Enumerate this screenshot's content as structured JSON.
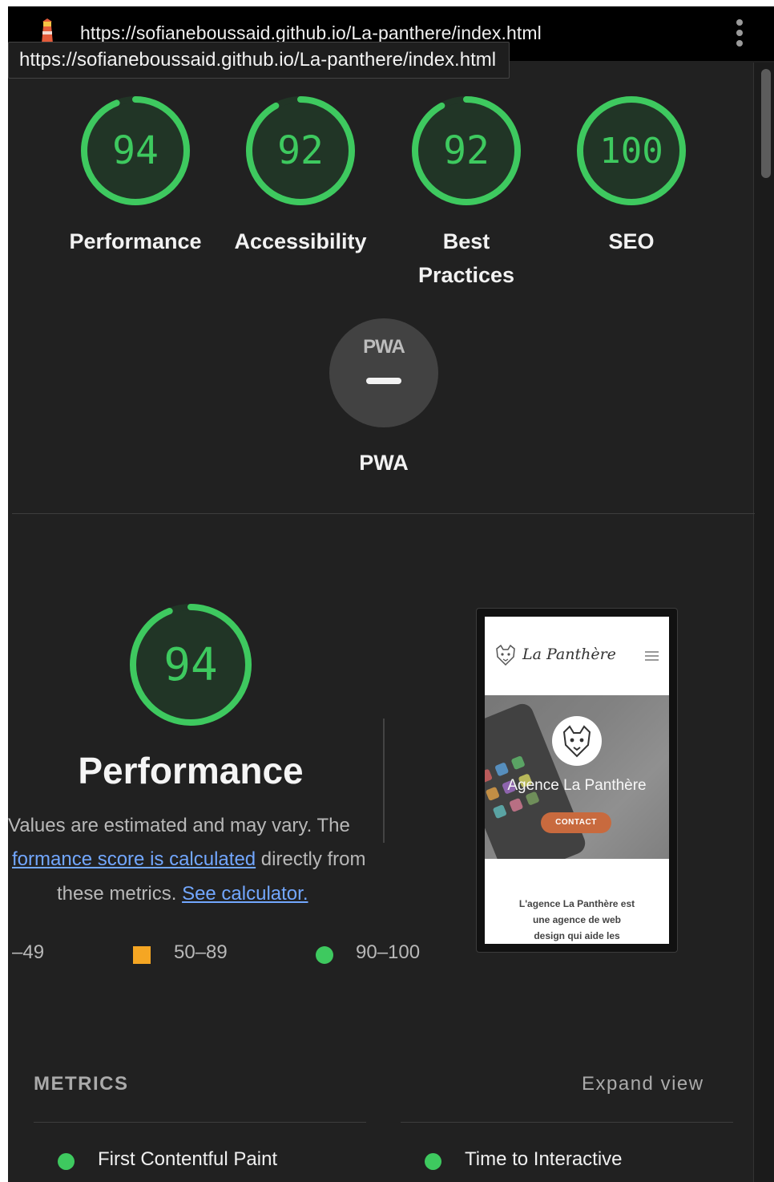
{
  "browser": {
    "url": "https://sofianeboussaid.github.io/La-panthere/index.html",
    "tooltip": "https://sofianeboussaid.github.io/La-panthere/index.html",
    "lighthouse_icon": "lighthouse-icon",
    "menu_icon": "kebab-menu-icon"
  },
  "scores": [
    {
      "value": 94,
      "display": "94",
      "label": "Performance"
    },
    {
      "value": 92,
      "display": "92",
      "label": "Accessibility"
    },
    {
      "value": 92,
      "display": "92",
      "label_line1": "Best",
      "label_line2": "Practices"
    },
    {
      "value": 100,
      "display": "100",
      "label": "SEO"
    }
  ],
  "pwa": {
    "badge_text": "PWA",
    "label": "PWA"
  },
  "performance": {
    "score": 94,
    "display": "94",
    "title": "Performance",
    "desc_line1": "Values are estimated and may vary. The",
    "desc_link1": "formance score is calculated",
    "desc_line2_rest": " directly from",
    "desc_line3": "these metrics.",
    "desc_link2": "See calculator."
  },
  "legend": {
    "fail": "–49",
    "average": "50–89",
    "pass": "90–100"
  },
  "preview": {
    "brand": "La Panthère",
    "hero_title": "Agence La Panthère",
    "cta": "CONTACT",
    "body_line1": "L'agence La Panthère est",
    "body_line2": "une agence de web",
    "body_line3": "design qui aide les"
  },
  "metrics": {
    "title": "METRICS",
    "expand": "Expand view",
    "items": [
      "First Contentful Paint",
      "Time to Interactive"
    ]
  },
  "colors": {
    "pass": "#3ec95f",
    "average": "#f5a623",
    "link": "#72a7ff",
    "background": "#212121"
  }
}
